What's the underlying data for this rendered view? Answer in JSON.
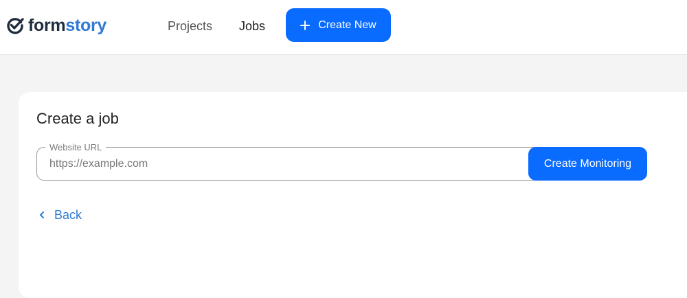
{
  "brand": {
    "name_part1": "form",
    "name_part2": "story",
    "logo_icon": "check-circle-icon"
  },
  "nav": {
    "projects_label": "Projects",
    "jobs_label": "Jobs",
    "create_new_label": "Create New",
    "create_new_icon": "plus-icon"
  },
  "job_form": {
    "title": "Create a job",
    "url_label": "Website URL",
    "url_placeholder": "https://example.com",
    "url_value": "",
    "submit_label": "Create Monitoring",
    "back_label": "Back",
    "back_icon": "chevron-left-icon"
  },
  "colors": {
    "accent": "#0a6bff",
    "link": "#2f7ad6",
    "brand_dark": "#1f2c3d",
    "page_bg": "#f4f4f4"
  }
}
